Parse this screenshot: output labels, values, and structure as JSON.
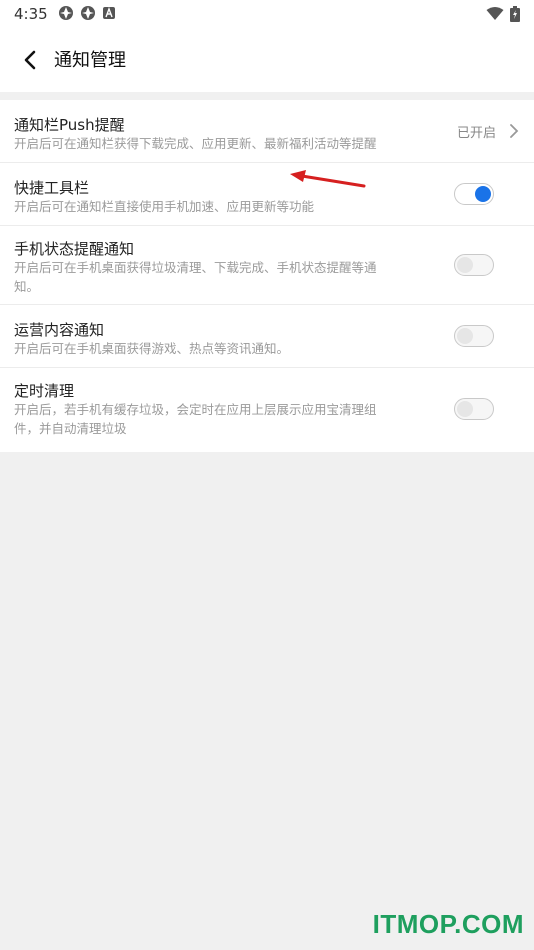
{
  "status_bar": {
    "time": "4:35"
  },
  "app_bar": {
    "title": "通知管理"
  },
  "settings": [
    {
      "title": "通知栏Push提醒",
      "desc": "开启后可在通知栏获得下载完成、应用更新、最新福利活动等提醒",
      "trailing": "已开启"
    },
    {
      "title": "快捷工具栏",
      "desc": "开启后可在通知栏直接使用手机加速、应用更新等功能",
      "enabled": true
    },
    {
      "title": "手机状态提醒通知",
      "desc_line1": "开启后可在手机桌面获得垃圾清理、下载完成、手机状态提醒等通",
      "desc_line2": "知。",
      "enabled": false
    },
    {
      "title": "运营内容通知",
      "desc": "开启后可在手机桌面获得游戏、热点等资讯通知。",
      "enabled": false
    },
    {
      "title": "定时清理",
      "desc_line1": "开启后，若手机有缓存垃圾，会定时在应用上层展示应用宝清理组",
      "desc_line2": "件，并自动清理垃圾",
      "enabled": false
    }
  ],
  "watermark": "ITMOP.COM",
  "colors": {
    "accent": "#1a73e8",
    "arrow": "#d62020",
    "watermark": "#1e9f5e"
  }
}
